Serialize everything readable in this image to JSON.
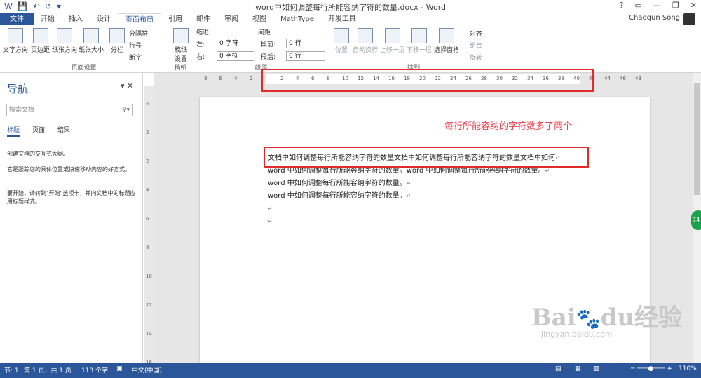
{
  "window": {
    "title": "word中如何调整每行所能容纳字符的数量.docx - Word",
    "qat": [
      "save-icon",
      "undo-icon",
      "redo-icon"
    ],
    "controls": [
      "?",
      "▭",
      "—",
      "❐",
      "✕"
    ]
  },
  "user": {
    "name": "Chaoqun Song"
  },
  "tabs": [
    "文件",
    "开始",
    "插入",
    "设计",
    "页面布局",
    "引用",
    "邮件",
    "审阅",
    "视图",
    "MathType",
    "开发工具"
  ],
  "active_tab": "页面布局",
  "ribbon": {
    "page_setup": {
      "label": "页面设置",
      "buttons": [
        "文字方向",
        "页边距",
        "纸张方向",
        "纸张大小",
        "分栏"
      ],
      "small": [
        "分隔符",
        "行号",
        "断字"
      ]
    },
    "draft": {
      "label": "稿纸",
      "button": "稿纸\n设置"
    },
    "paragraph": {
      "label": "段落",
      "indent": "缩进",
      "spacing": "间距",
      "left_label": "左:",
      "right_label": "右:",
      "before_label": "段前:",
      "after_label": "段后:",
      "left": "0 字符",
      "right": "0 字符",
      "before": "0 行",
      "after": "0 行"
    },
    "arrange": {
      "label": "排列",
      "buttons": [
        "位置",
        "自动换行",
        "上移一层",
        "下移一层",
        "选择窗格"
      ],
      "small": [
        "对齐",
        "组合",
        "旋转"
      ]
    }
  },
  "nav": {
    "title": "导航",
    "search_placeholder": "搜索文档",
    "tabs": [
      "标题",
      "页面",
      "结果"
    ],
    "texts": [
      "创建文档的交互式大纲。",
      "它是跟踪您的具体位置或快速移动内容的好方式。",
      "要开始，请转到\"开始\"选项卡，并向文档中的标题应用标题样式。"
    ]
  },
  "ruler": {
    "numbers": [
      "8",
      "6",
      "4",
      "2",
      "2",
      "4",
      "6",
      "8",
      "10",
      "12",
      "14",
      "16",
      "18",
      "20",
      "22",
      "24",
      "26",
      "28",
      "30",
      "32",
      "34",
      "36",
      "38",
      "40",
      "42",
      "44",
      "46",
      "48"
    ],
    "vnumbers": [
      "4",
      "2",
      "2",
      "4",
      "6",
      "8",
      "10",
      "12",
      "14",
      "16"
    ]
  },
  "doc": {
    "lines": [
      "文档中如何调整每行所能容纳字符的数量文档中如何调整每行所能容纳字符的数量文档中如何",
      "word 中如何调整每行所能容纳字符的数量。word 中如何调整每行所能容纳字符的数量。",
      "word 中如何调整每行所能容纳字符的数量。",
      "word 中如何调整每行所能容纳字符的数量。",
      "",
      ""
    ],
    "mark": "↵"
  },
  "annotation": "每行所能容纳的字符数多了两个",
  "status": {
    "section": "节: 1",
    "page": "第 1 页，共 1 页",
    "words": "113 个字",
    "lang": "中文(中国)",
    "zoom": "110%"
  },
  "badge": "74",
  "watermark": {
    "logo": "Baidu经验",
    "url": "jingyan.baidu.com"
  }
}
